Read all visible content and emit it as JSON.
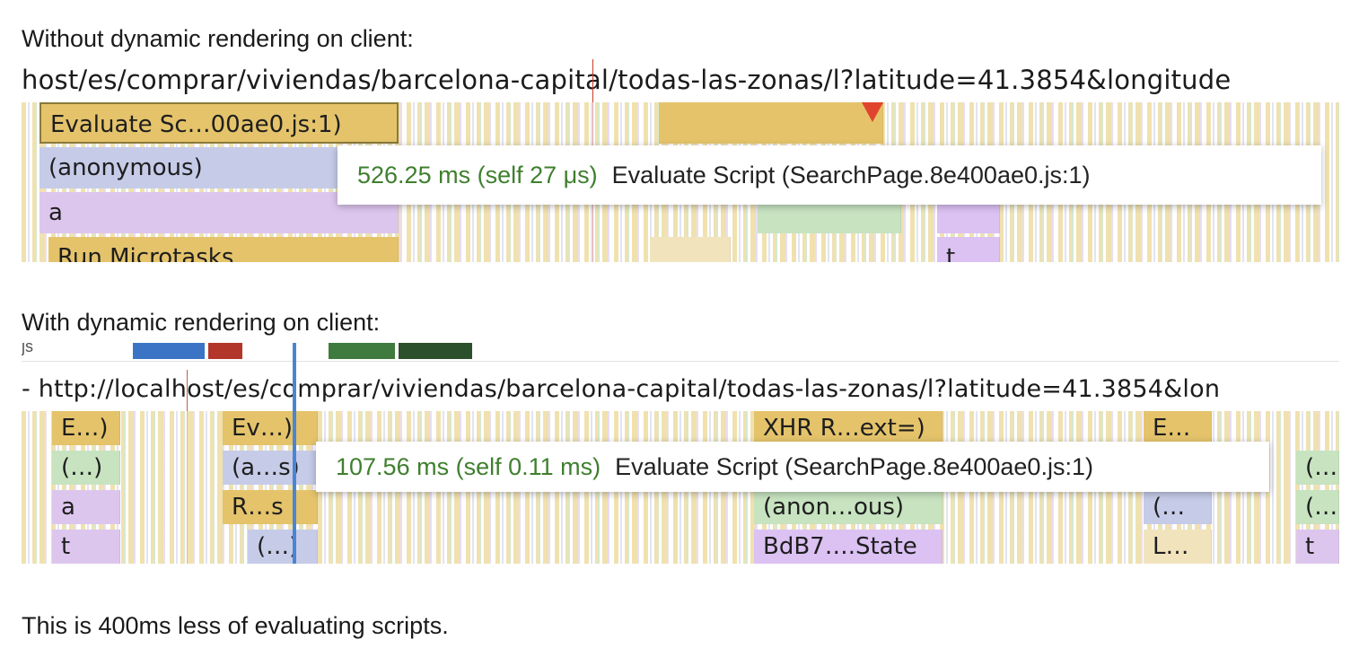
{
  "caption_without": "Without dynamic rendering on client:",
  "caption_with": "With dynamic rendering on client:",
  "conclusion": "This is 400ms less of evaluating scripts.",
  "shot1": {
    "url": "host/es/comprar/viviendas/barcelona-capital/todas-las-zonas/l?latitude=41.3854&longitude",
    "boxes": [
      "Evaluate Sc…00ae0.js:1)",
      "(anonymous)",
      "a",
      "Run Microtasks",
      "t"
    ],
    "tooltip": {
      "time": "526.25 ms (self 27 μs)",
      "label": "Evaluate Script (SearchPage.8e400ae0.js:1)"
    }
  },
  "shot2": {
    "top_label": "js",
    "url": "- http://localhost/es/comprar/viviendas/barcelona-capital/todas-las-zonas/l?latitude=41.3854&lon",
    "boxes": [
      "E…)",
      "Ev…)",
      "XHR R…ext=)",
      "E…",
      "(…)",
      "(a…s)",
      "(…",
      "a",
      "R…s",
      "(anon…ous)",
      "(…",
      "(…",
      "t",
      "(…)",
      "BdB7….State",
      "L…",
      "t"
    ],
    "tooltip": {
      "time": "107.56 ms (self 0.11 ms)",
      "label": "Evaluate Script (SearchPage.8e400ae0.js:1)"
    }
  },
  "colors": {
    "scripting": "#e4c36b",
    "tooltip_time": "#3f7f2e",
    "marker_blue": "#3b74c4",
    "marker_red": "#b3362a",
    "marker_green": "#3f7a3f",
    "marker_dark_green": "#2c4f2c"
  }
}
